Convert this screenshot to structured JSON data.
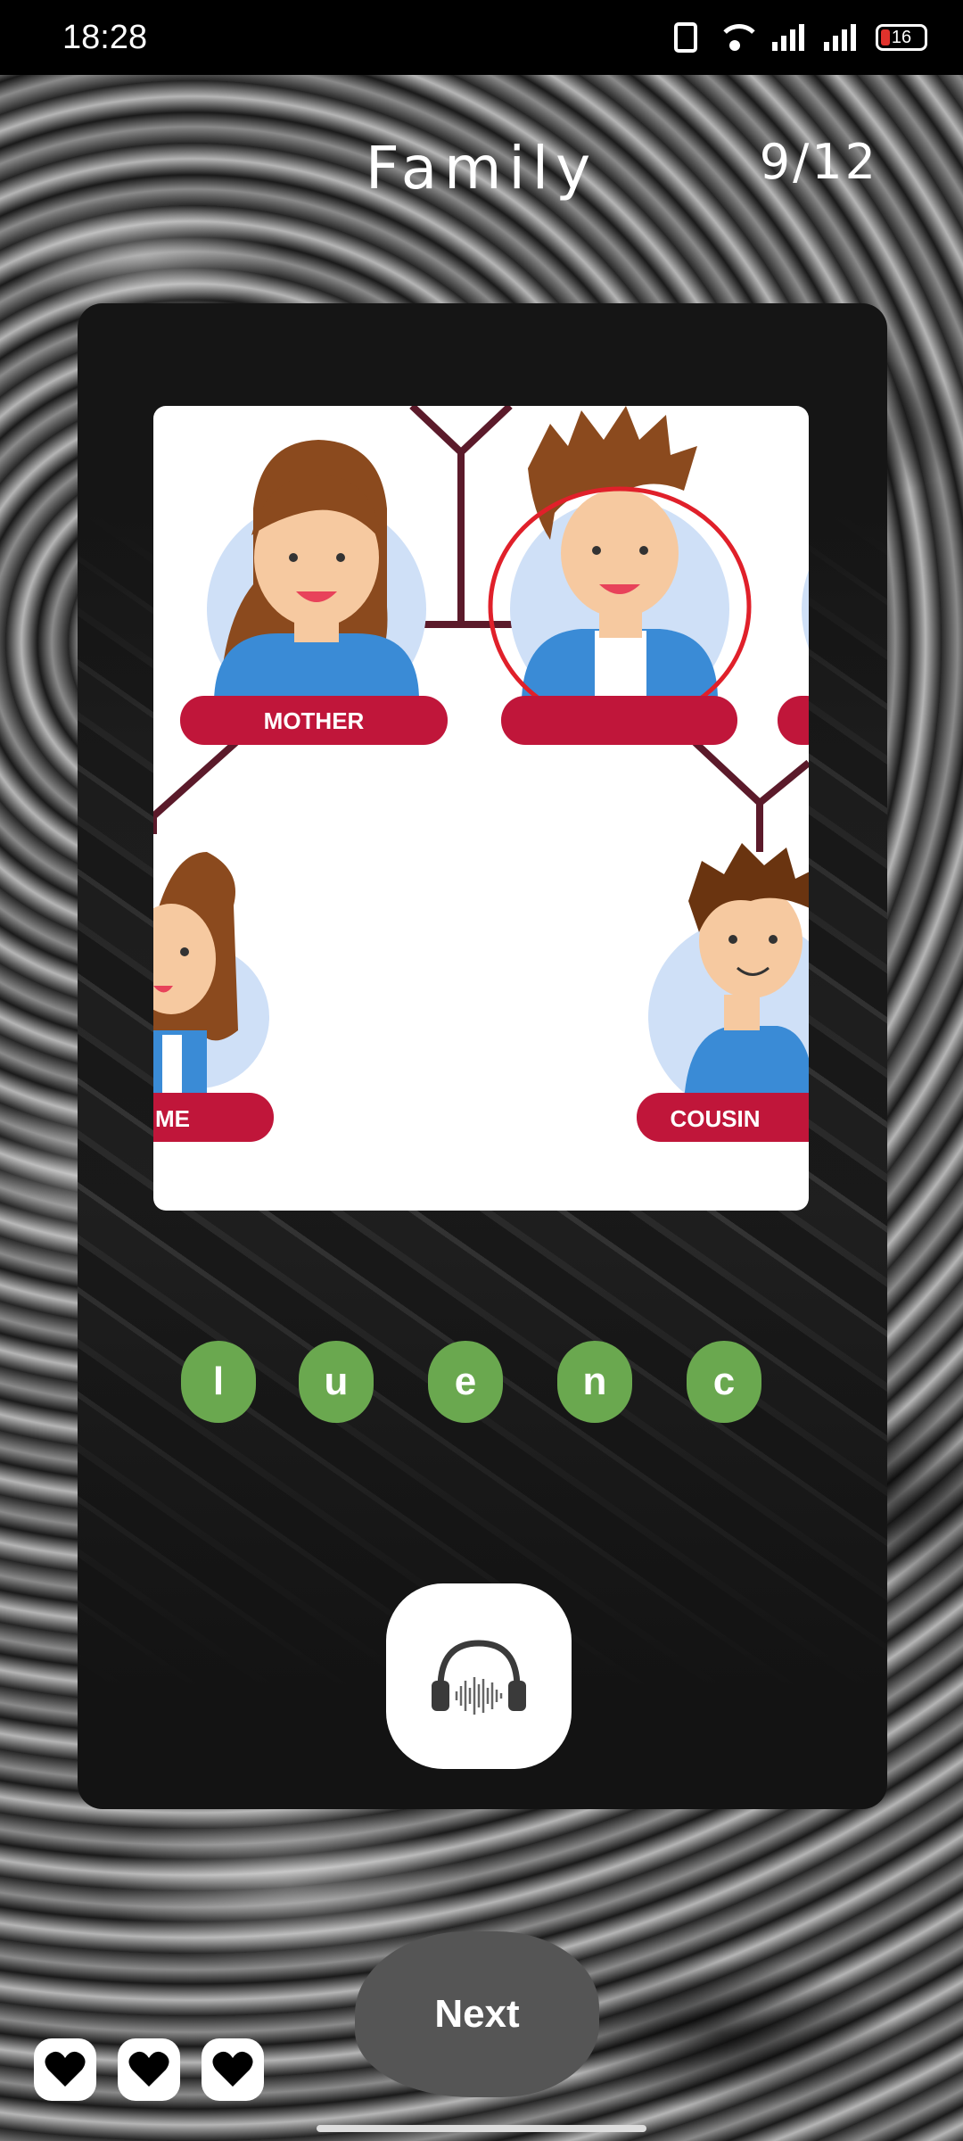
{
  "status_bar": {
    "time": "18:28",
    "battery_level": "16",
    "icons": [
      "vibrate-icon",
      "wifi-icon",
      "signal-icon",
      "signal-icon",
      "battery-icon"
    ]
  },
  "header": {
    "title": "Family",
    "progress": "9/12"
  },
  "picture": {
    "labels": {
      "mother": "MOTHER",
      "left_partial": "ME",
      "cousin": "COUSIN"
    },
    "colors": {
      "label_red": "#c0163a",
      "line": "#5b1a2a",
      "circle_bg": "#cfe0f7",
      "hair": "#8b4a1e",
      "skin": "#f6c9a0",
      "shirt": "#3a8bd6",
      "highlight_ring": "#e0202a"
    }
  },
  "letter_tiles": [
    "l",
    "u",
    "e",
    "n",
    "c"
  ],
  "audio_button": {
    "icon": "headphones-icon"
  },
  "next_button": {
    "label": "Next"
  },
  "lives": {
    "count": 3,
    "icon": "heart-icon"
  },
  "colors": {
    "tile_green": "#6aa84f",
    "button_gray": "#555555",
    "card_dark": "#151515"
  }
}
